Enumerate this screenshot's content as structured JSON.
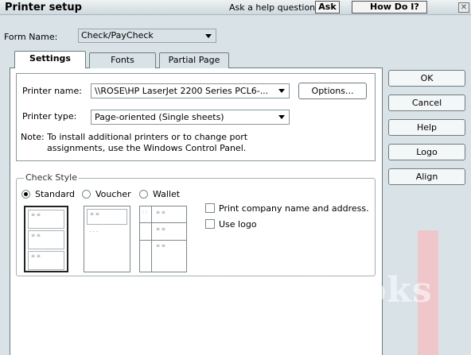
{
  "window": {
    "title": "Printer setup",
    "help_prompt": "Ask a help question",
    "ask_label": "Ask",
    "how_do_label": "How Do I?"
  },
  "form_name": {
    "label": "Form Name:",
    "value": "Check/PayCheck"
  },
  "tabs": [
    {
      "label": "Settings",
      "active": true
    },
    {
      "label": "Fonts",
      "active": false
    },
    {
      "label": "Partial Page",
      "active": false
    }
  ],
  "settings": {
    "printer_name_label": "Printer name:",
    "printer_name_value": "\\\\ROSE\\HP LaserJet 2200 Series PCL6-...",
    "options_label": "Options...",
    "printer_type_label": "Printer type:",
    "printer_type_value": "Page-oriented (Single sheets)",
    "note_line1": "Note: To install additional printers or to change port",
    "note_line2": "assignments, use the Windows Control Panel."
  },
  "check_style": {
    "label": "Check Style",
    "options": [
      {
        "label": "Standard",
        "selected": true
      },
      {
        "label": "Voucher",
        "selected": false
      },
      {
        "label": "Wallet",
        "selected": false
      }
    ],
    "print_company_label": "Print company name and address.",
    "use_logo_label": "Use logo"
  },
  "buttons": {
    "ok": "OK",
    "cancel": "Cancel",
    "help": "Help",
    "logo": "Logo",
    "align": "Align"
  },
  "watermark": "DropBooks",
  "colors": {
    "background": "#d9e3e7",
    "panel": "#ffffff",
    "watermark_pink": "#efc7cb"
  }
}
